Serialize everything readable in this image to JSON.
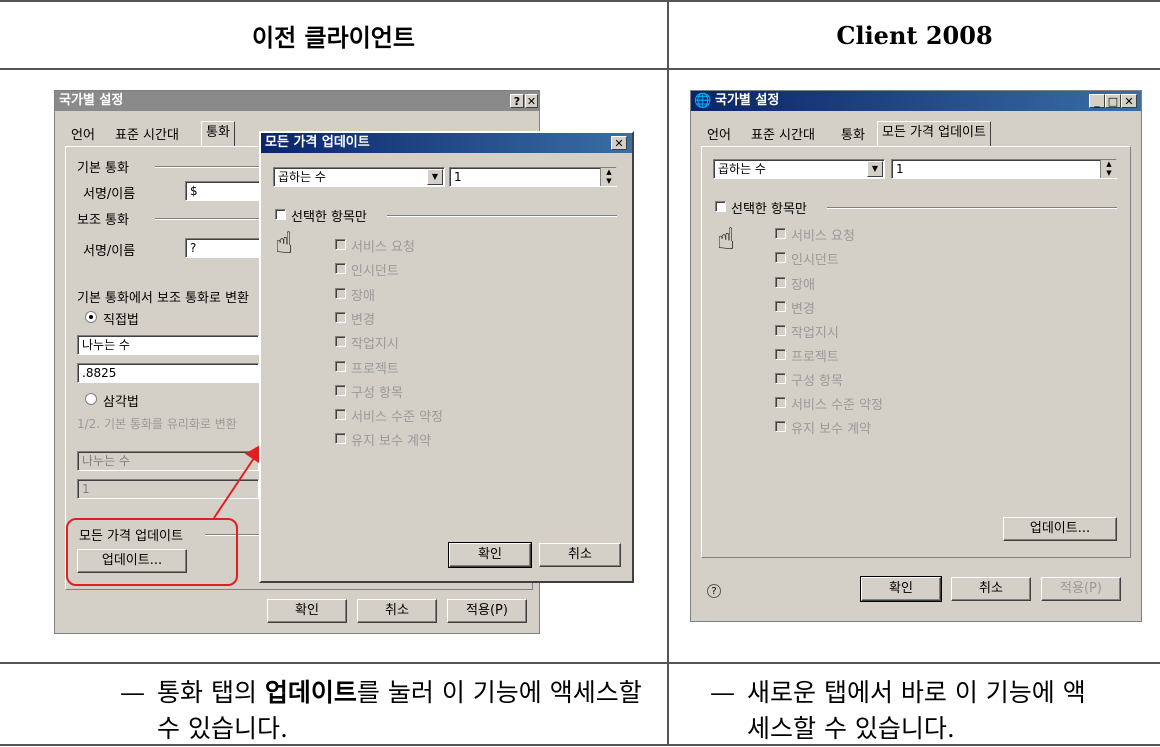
{
  "header": {
    "left_title": "이전 클라이언트",
    "right_title": "Client 2008"
  },
  "old": {
    "main_title": "국가별 설정",
    "tabs": [
      "언어",
      "표준 시간대",
      "통화"
    ],
    "base_currency": "기본 통화",
    "sign_name": "서명/이름",
    "base_value": "$",
    "sub_currency": "보조 통화",
    "sub_value": "?",
    "convert_label": "기본 통화에서 보조 통화로 변환",
    "direct": "직접법",
    "op": "나누는 수",
    "rate": ".8825",
    "triangular": "삼각법",
    "tri_desc": "1/2. 기본 통화를 유리화로 변환",
    "op2": "나누는 수",
    "rate2": "1",
    "update_group": "모든 가격 업데이트",
    "update_button": "업데이트...",
    "ok": "확인",
    "cancel": "취소",
    "apply": "적용(P)",
    "dialog": {
      "title": "모든 가격 업데이트",
      "op": "곱하는 수",
      "value": "1",
      "selected_only": "선택한 항목만",
      "items": [
        "서비스 요청",
        "인시던트",
        "장애",
        "변경",
        "작업지시",
        "프로젝트",
        "구성 항목",
        "서비스 수준 약정",
        "유지 보수 계약"
      ],
      "ok": "확인",
      "cancel": "취소"
    }
  },
  "new": {
    "title": "국가별 설정",
    "tabs": [
      "언어",
      "표준 시간대",
      "통화",
      "모든 가격 업데이트"
    ],
    "op": "곱하는 수",
    "value": "1",
    "selected_only": "선택한 항목만",
    "items": [
      "서비스 요청",
      "인시던트",
      "장애",
      "변경",
      "작업지시",
      "프로젝트",
      "구성 항목",
      "서비스 수준 약정",
      "유지 보수 계약"
    ],
    "update_button": "업데이트...",
    "help": "?",
    "ok": "확인",
    "cancel": "취소",
    "apply": "적용(P)"
  },
  "captions": {
    "dash": "—",
    "left_plain1": "통화 탭의 ",
    "left_bold": "업데이트",
    "left_plain2": "를 눌러 이 기능에 액세스할",
    "left_line2": "수 있습니다.",
    "right_line1": "새로운 탭에서 바로 이 기능에 액",
    "right_line2": "세스할 수 있습니다."
  },
  "colors": {
    "highlight": "#e02020",
    "titlebar": "#0a246a",
    "window": "#d4d0c8"
  }
}
